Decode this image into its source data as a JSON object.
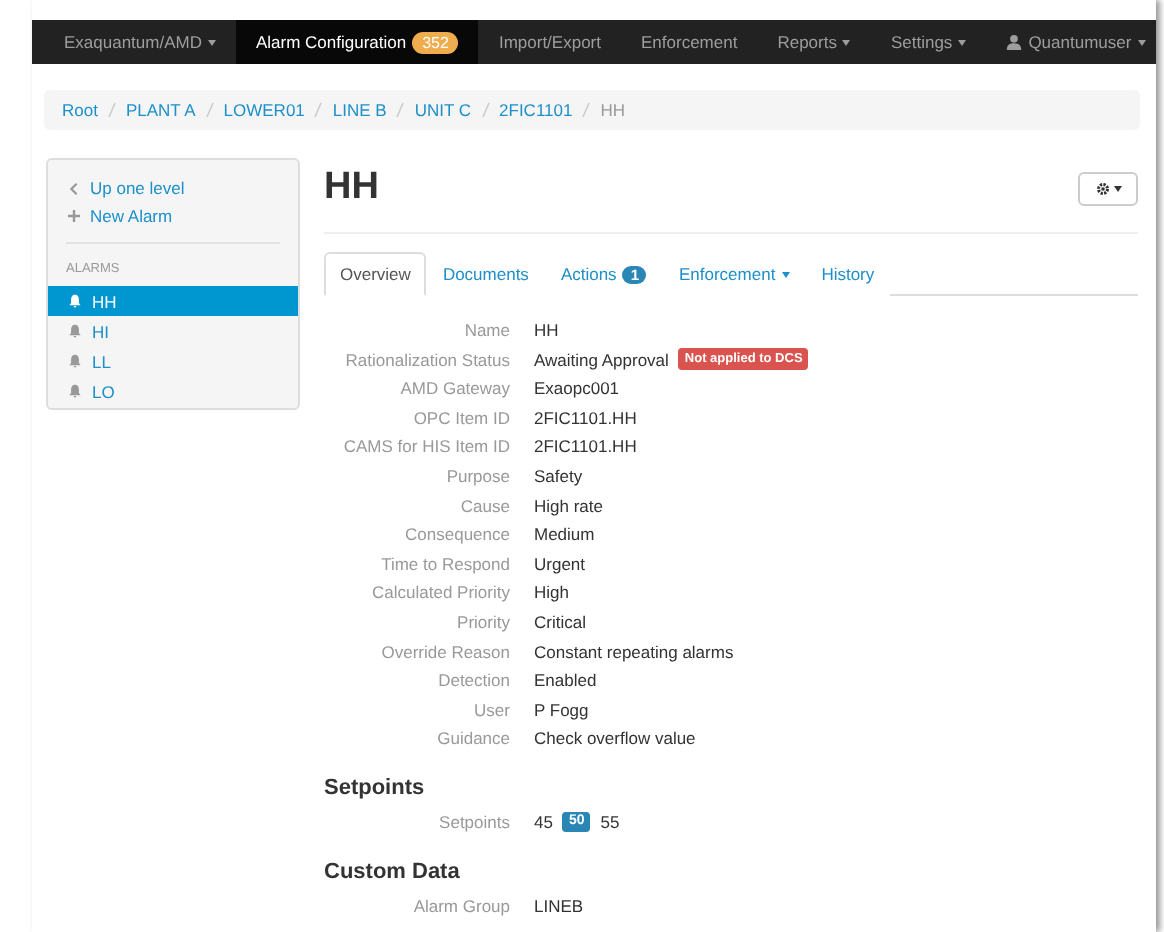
{
  "navbar": {
    "items": [
      {
        "label": "Exaquantum/AMD",
        "kind": "dropdown",
        "selected": false
      },
      {
        "label": "Alarm Configuration",
        "kind": "badge",
        "badge": "352",
        "selected": true
      },
      {
        "label": "Import/Export",
        "kind": "link",
        "selected": false
      },
      {
        "label": "Enforcement",
        "kind": "link",
        "selected": false
      },
      {
        "label": "Reports",
        "kind": "dropdown",
        "selected": false
      },
      {
        "label": "Settings",
        "kind": "dropdown",
        "selected": false
      }
    ],
    "user": "Quantumuser"
  },
  "breadcrumb": [
    "Root",
    "PLANT A",
    "LOWER01",
    "LINE B",
    "UNIT C",
    "2FIC1101",
    "HH"
  ],
  "sidebar": {
    "actions": [
      {
        "label": "Up one level",
        "kind": "up"
      },
      {
        "label": "New Alarm",
        "kind": "new"
      }
    ],
    "heading": "ALARMS",
    "items": [
      {
        "label": "HH",
        "selected": true
      },
      {
        "label": "HI",
        "selected": false
      },
      {
        "label": "LL",
        "selected": false
      },
      {
        "label": "LO",
        "selected": false
      }
    ]
  },
  "title": "HH",
  "tabs": [
    {
      "label": "Overview",
      "selected": true
    },
    {
      "label": "Documents",
      "selected": false
    },
    {
      "label": "Actions",
      "badge": "1",
      "selected": false
    },
    {
      "label": "Enforcement",
      "dropdown": true,
      "selected": false
    },
    {
      "label": "History",
      "selected": false
    }
  ],
  "details": [
    {
      "label": "Name",
      "value": "HH"
    },
    {
      "label": "Rationalization Status",
      "value": "Awaiting Approval",
      "tag": "Not applied to DCS"
    },
    {
      "label": "AMD Gateway",
      "value": "Exaopc001"
    },
    {
      "label": "OPC Item ID",
      "value": "2FIC1101.HH"
    },
    {
      "label": "CAMS for HIS Item ID",
      "value": "2FIC1101.HH"
    },
    {
      "label": "Purpose",
      "value": "Safety"
    },
    {
      "label": "Cause",
      "value": "High rate"
    },
    {
      "label": "Consequence",
      "value": "Medium"
    },
    {
      "label": "Time to Respond",
      "value": "Urgent"
    },
    {
      "label": "Calculated Priority",
      "value": "High"
    },
    {
      "label": "Priority",
      "value": "Critical"
    },
    {
      "label": "Override Reason",
      "value": "Constant repeating alarms"
    },
    {
      "label": "Detection",
      "value": "Enabled"
    },
    {
      "label": "User",
      "value": "P Fogg"
    },
    {
      "label": "Guidance",
      "value": "Check overflow value"
    }
  ],
  "setpoints": {
    "heading": "Setpoints",
    "label": "Setpoints",
    "values": [
      {
        "value": "45",
        "selected": false
      },
      {
        "value": "50",
        "selected": true
      },
      {
        "value": "55",
        "selected": false
      }
    ]
  },
  "custom_data": {
    "heading": "Custom Data",
    "rows": [
      {
        "label": "Alarm Group",
        "value": "LINEB"
      }
    ]
  }
}
